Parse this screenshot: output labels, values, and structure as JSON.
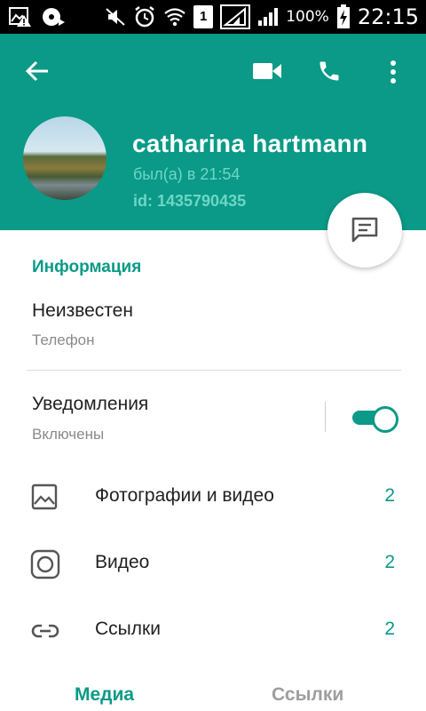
{
  "status_bar": {
    "battery_percent": "100%",
    "time": "22:15",
    "sim_label": "1",
    "icons": [
      "gallery-warning-icon",
      "media-icon",
      "mute-icon",
      "alarm-icon",
      "wifi-icon",
      "sim-icon",
      "signal-icon",
      "signal-icon",
      "battery-charging-icon"
    ]
  },
  "header": {
    "name": "catharina hartmann",
    "last_seen": "был(а) в 21:54",
    "user_id": "id: 1435790435",
    "actions": [
      "back-arrow-icon",
      "video-call-icon",
      "phone-call-icon",
      "more-vert-icon"
    ],
    "accent_color": "#0a9a87"
  },
  "info": {
    "section_title": "Информация",
    "phone_value": "Неизвестен",
    "phone_label": "Телефон",
    "notifications_value": "Уведомления",
    "notifications_label": "Включены",
    "notifications_enabled": true
  },
  "media": [
    {
      "label": "Фотографии и видео",
      "count": "2",
      "icon": "photo-icon"
    },
    {
      "label": "Видео",
      "count": "2",
      "icon": "video-round-icon"
    },
    {
      "label": "Ссылки",
      "count": "2",
      "icon": "link-icon"
    }
  ],
  "tabs": {
    "media": "Медиа",
    "links": "Ссылки",
    "active": "media"
  }
}
